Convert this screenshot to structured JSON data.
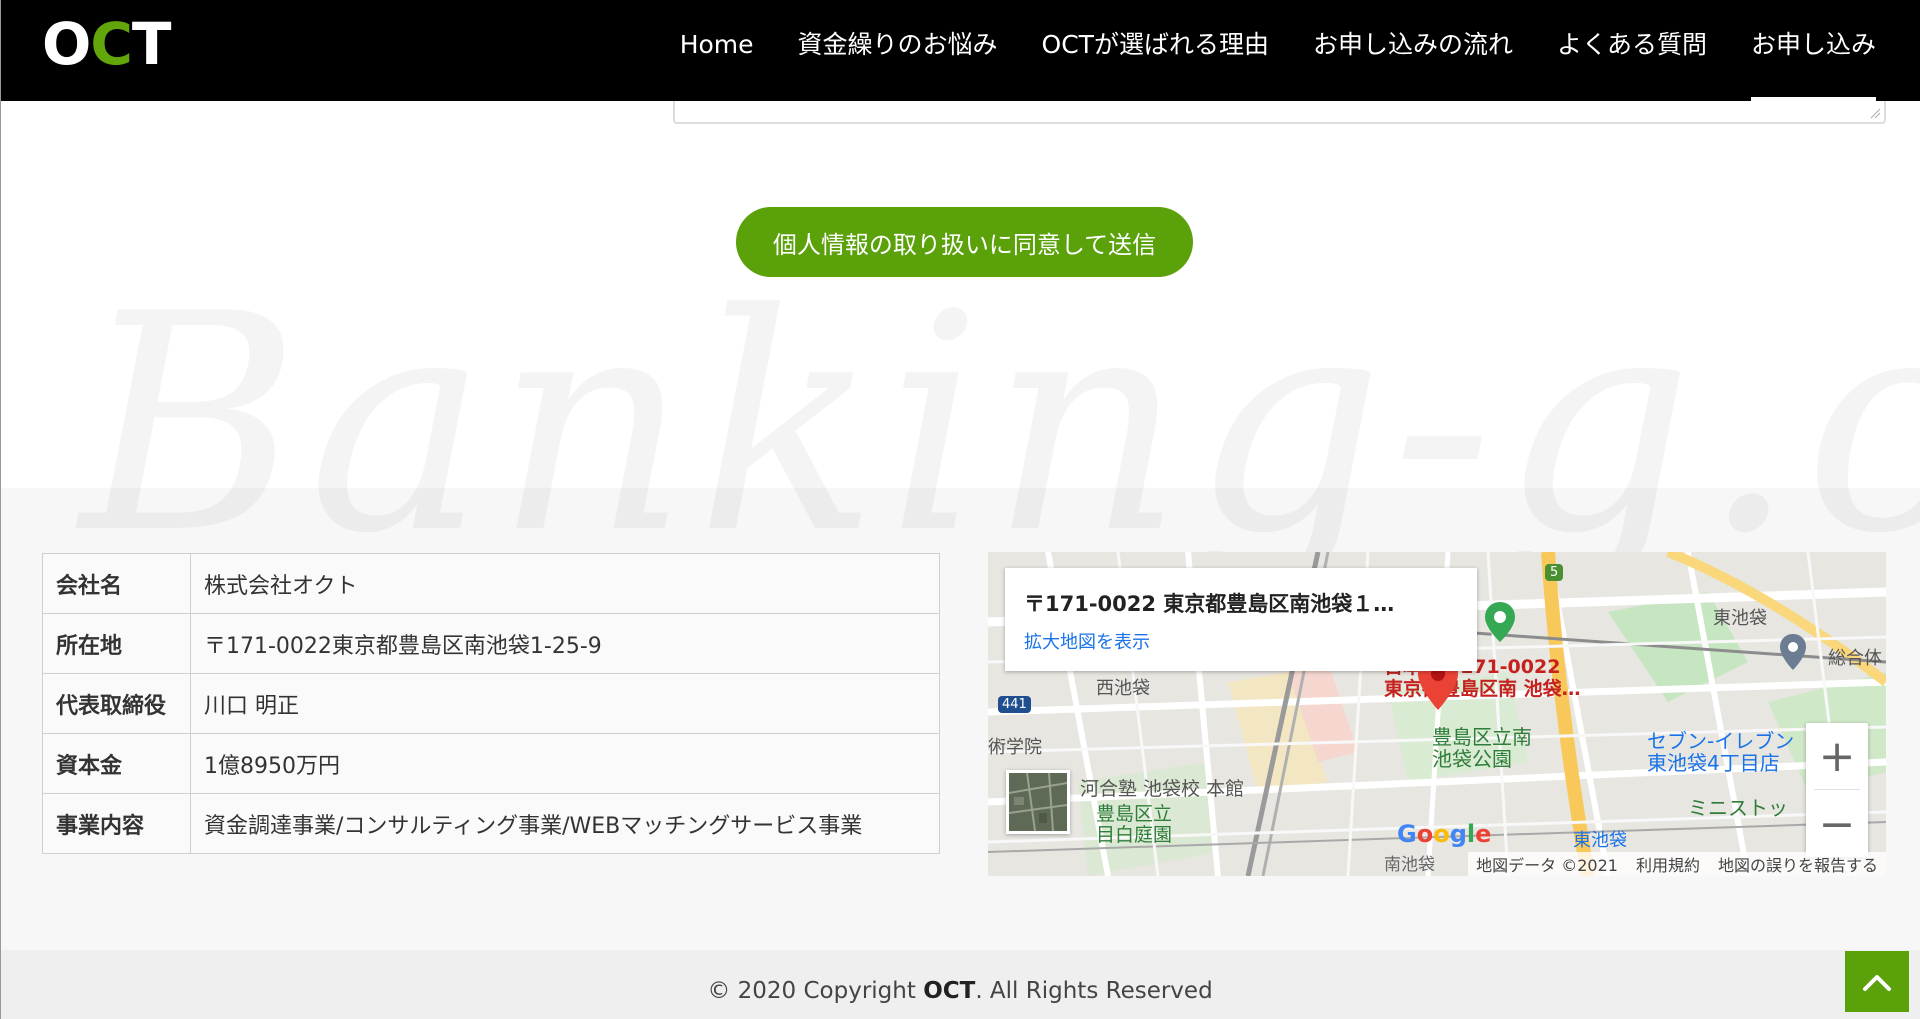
{
  "header": {
    "logo": {
      "prefix": "O",
      "accent": "C",
      "suffix": "T"
    },
    "nav": [
      "Home",
      "資金繰りのお悩み",
      "OCTが選ばれる理由",
      "お申し込みの流れ",
      "よくある質問",
      "お申し込み"
    ],
    "active_nav": "お申し込み",
    "accent_color": "#62a60c"
  },
  "form": {
    "submit_label": "個人情報の取り扱いに同意して送信"
  },
  "watermark": "Banking-g.com",
  "company": {
    "rows": [
      {
        "key": "会社名",
        "value": "株式会社オクト"
      },
      {
        "key": "所在地",
        "value": "〒171-0022東京都豊島区南池袋1-25-9"
      },
      {
        "key": "代表取締役",
        "value": "川口 明正"
      },
      {
        "key": "資本金",
        "value": "1億8950万円"
      },
      {
        "key": "事業内容",
        "value": "資金調達事業/コンサルティング事業/WEBマッチングサービス事業"
      }
    ]
  },
  "map": {
    "card_address": "〒171-0022 東京都豊島区南池袋１…",
    "card_link": "拡大地図を表示",
    "labels": {
      "marker_label_1": "日本、〒171-0022",
      "marker_label_2": "東京都豊島区南 池袋…",
      "nishi": "西池袋",
      "higashi": "東池袋",
      "sogo": "総合体",
      "park_1": "豊島区立南",
      "park_2": "池袋公園",
      "seven_1": "セブン-イレブン",
      "seven_2": "東池袋4丁目店",
      "mini": "ミニストッ",
      "kawai": "河合塾 池袋校 本館",
      "garden_1": "豊島区立",
      "garden_2": "目白庭園",
      "station": "東池袋",
      "gakuin": "術学院",
      "route": "441",
      "route5": "5",
      "minami": "南池袋",
      "ike": "池袋"
    },
    "google": "Google",
    "attribution": [
      "地図データ ©2021",
      "利用規約",
      "地図の誤りを報告する"
    ],
    "zoom_in": "+",
    "zoom_out": "−"
  },
  "footer": {
    "copyright_prefix": "© 2020 Copyright ",
    "copyright_brand": "OCT",
    "copyright_suffix": ". All Rights Reserved"
  }
}
